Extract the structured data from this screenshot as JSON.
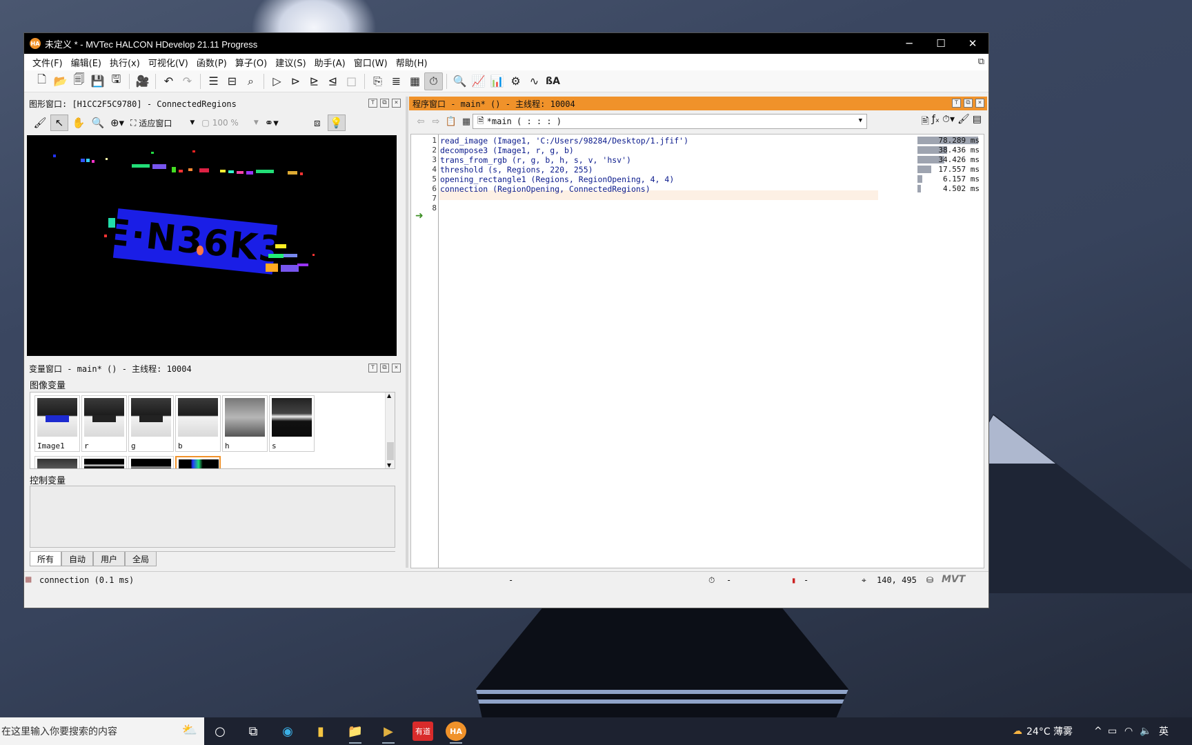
{
  "window": {
    "title": "未定义 * - MVTec HALCON HDevelop 21.11 Progress",
    "minimize": "─",
    "maximize": "☐",
    "close": "✕"
  },
  "menu": [
    "文件(F)",
    "编辑(E)",
    "执行(x)",
    "可视化(V)",
    "函数(P)",
    "算子(O)",
    "建议(S)",
    "助手(A)",
    "窗口(W)",
    "帮助(H)"
  ],
  "graphics_window": {
    "title": "图形窗口: [H1CC2F5C9780] - ConnectedRegions",
    "fit_label": "适应窗口",
    "zoom_label": "100 %",
    "plate_text": "E·N36K3"
  },
  "variable_window": {
    "title": "变量窗口 - main* () - 主线程: 10004",
    "image_vars_label": "图像变量",
    "image_vars": [
      "Image1",
      "r",
      "g",
      "b",
      "h",
      "s"
    ],
    "control_vars_label": "控制变量",
    "tabs": [
      "所有",
      "自动",
      "用户",
      "全局"
    ],
    "active_tab": "所有"
  },
  "program_window": {
    "title": "程序窗口 - main* () - 主线程: 10004",
    "procedure": "*main ( : : : )",
    "lines": [
      {
        "n": "1",
        "code": "read_image (Image1, 'C:/Users/98284/Desktop/1.jfif')",
        "time": "78.289 ms",
        "bar": 78.289
      },
      {
        "n": "2",
        "code": "decompose3 (Image1, r, g, b)",
        "time": "38.436 ms",
        "bar": 38.436
      },
      {
        "n": "3",
        "code": "trans_from_rgb (r, g, b, h, s, v, 'hsv')",
        "time": "34.426 ms",
        "bar": 34.426
      },
      {
        "n": "4",
        "code": "threshold (s, Regions, 220, 255)",
        "time": "17.557 ms",
        "bar": 17.557
      },
      {
        "n": "5",
        "code": "opening_rectangle1 (Regions, RegionOpening, 4, 4)",
        "time": "6.157 ms",
        "bar": 6.157
      },
      {
        "n": "6",
        "code": "connection (RegionOpening, ConnectedRegions)",
        "time": "4.502 ms",
        "bar": 4.502
      },
      {
        "n": "7",
        "code": "",
        "time": "",
        "bar": 0
      },
      {
        "n": "8",
        "code": "",
        "time": "",
        "bar": 0
      }
    ]
  },
  "status": {
    "message": "connection (0.1 ms)",
    "dash1": "-",
    "dash2": "-",
    "dash3": "-",
    "coords": "140, 495",
    "logo": "MVT"
  },
  "taskbar": {
    "search_placeholder": "在这里输入你要搜索的内容",
    "weather": "24°C 薄雾",
    "ime": "英"
  },
  "colors": {
    "program_title_bg": "#f0922a",
    "plate_blue": "#1a1ee6",
    "code_text": "#0a1a8c",
    "exec_arrow": "#3e8f26"
  }
}
